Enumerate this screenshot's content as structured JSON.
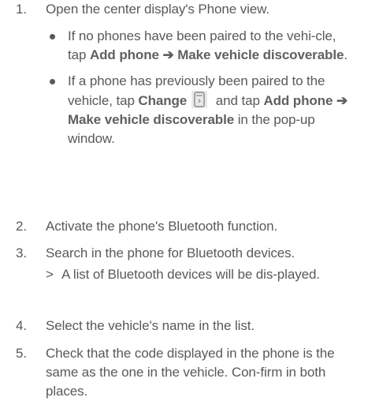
{
  "steps": [
    {
      "number": "1.",
      "text": "Open the center display's Phone view.",
      "bullets": [
        {
          "pre": "If no phones have been paired to the vehi-cle, tap ",
          "bold1": "Add phone",
          "arrow": "➔",
          "bold2": "Make vehicle discoverable",
          "post": "."
        },
        {
          "pre": "If a phone has previously been paired to the vehicle, tap ",
          "bold_change": "Change",
          "icon": "phone-change-icon",
          "mid": " and tap ",
          "bold1": "Add phone",
          "arrow": "➔",
          "bold2": "Make vehicle discoverable",
          "post": " in the pop-up window."
        }
      ]
    },
    {
      "number": "2.",
      "text": "Activate the phone's Bluetooth function."
    },
    {
      "number": "3.",
      "text": "Search in the phone for Bluetooth devices.",
      "result_marker": ">",
      "result": "A list of Bluetooth devices will be dis-played."
    },
    {
      "number": "4.",
      "text": "Select the vehicle's name in the list."
    },
    {
      "number": "5.",
      "text": "Check that the code displayed in the phone is the same as the one in the vehicle. Con-firm in both places."
    }
  ],
  "colors": {
    "text": "#595959",
    "icon_bg": "#e9e9e9"
  }
}
